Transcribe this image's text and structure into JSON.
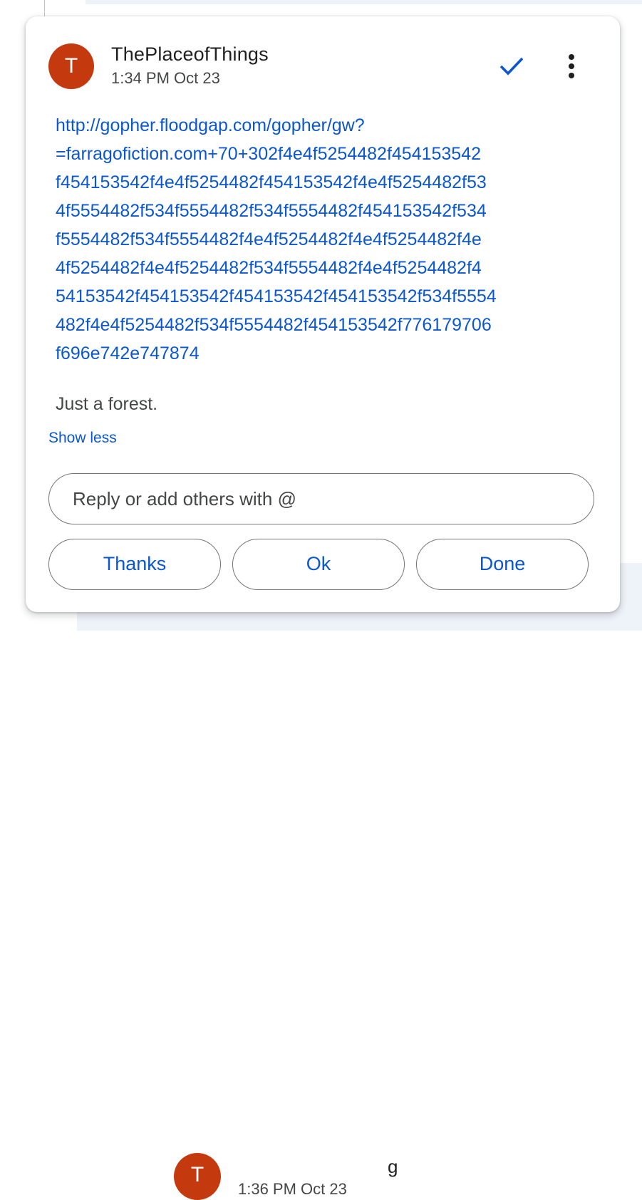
{
  "comment": {
    "avatar_initial": "T",
    "author": "ThePlaceofThings",
    "timestamp": "1:34 PM Oct 23",
    "link_lines": [
      "http://gopher.floodgap.com/gopher/gw?",
      "=farragofiction.com+70+302f4e4f5254482f454153542",
      "f454153542f4e4f5254482f454153542f4e4f5254482f53",
      "4f5554482f534f5554482f534f5554482f454153542f534",
      "f5554482f534f5554482f4e4f5254482f4e4f5254482f4e",
      "4f5254482f4e4f5254482f534f5554482f4e4f5254482f4",
      "54153542f454153542f454153542f454153542f534f5554",
      "482f4e4f5254482f534f5554482f454153542f776179706",
      "f696e742e747874"
    ],
    "text": "Just a forest.",
    "show_less_label": "Show less"
  },
  "reply": {
    "placeholder": "Reply or add others with @"
  },
  "quick_replies": [
    "Thanks",
    "Ok",
    "Done"
  ],
  "next_comment": {
    "avatar_initial": "T",
    "timestamp": "1:36 PM Oct 23",
    "author_partial": "g"
  },
  "colors": {
    "accent": "#0b57d0",
    "avatar": "#c5390e",
    "text_primary": "#1f1f1f",
    "text_secondary": "#444746",
    "outline": "#747775"
  },
  "icons": {
    "resolve": "check-icon",
    "more": "more-vert-icon"
  }
}
